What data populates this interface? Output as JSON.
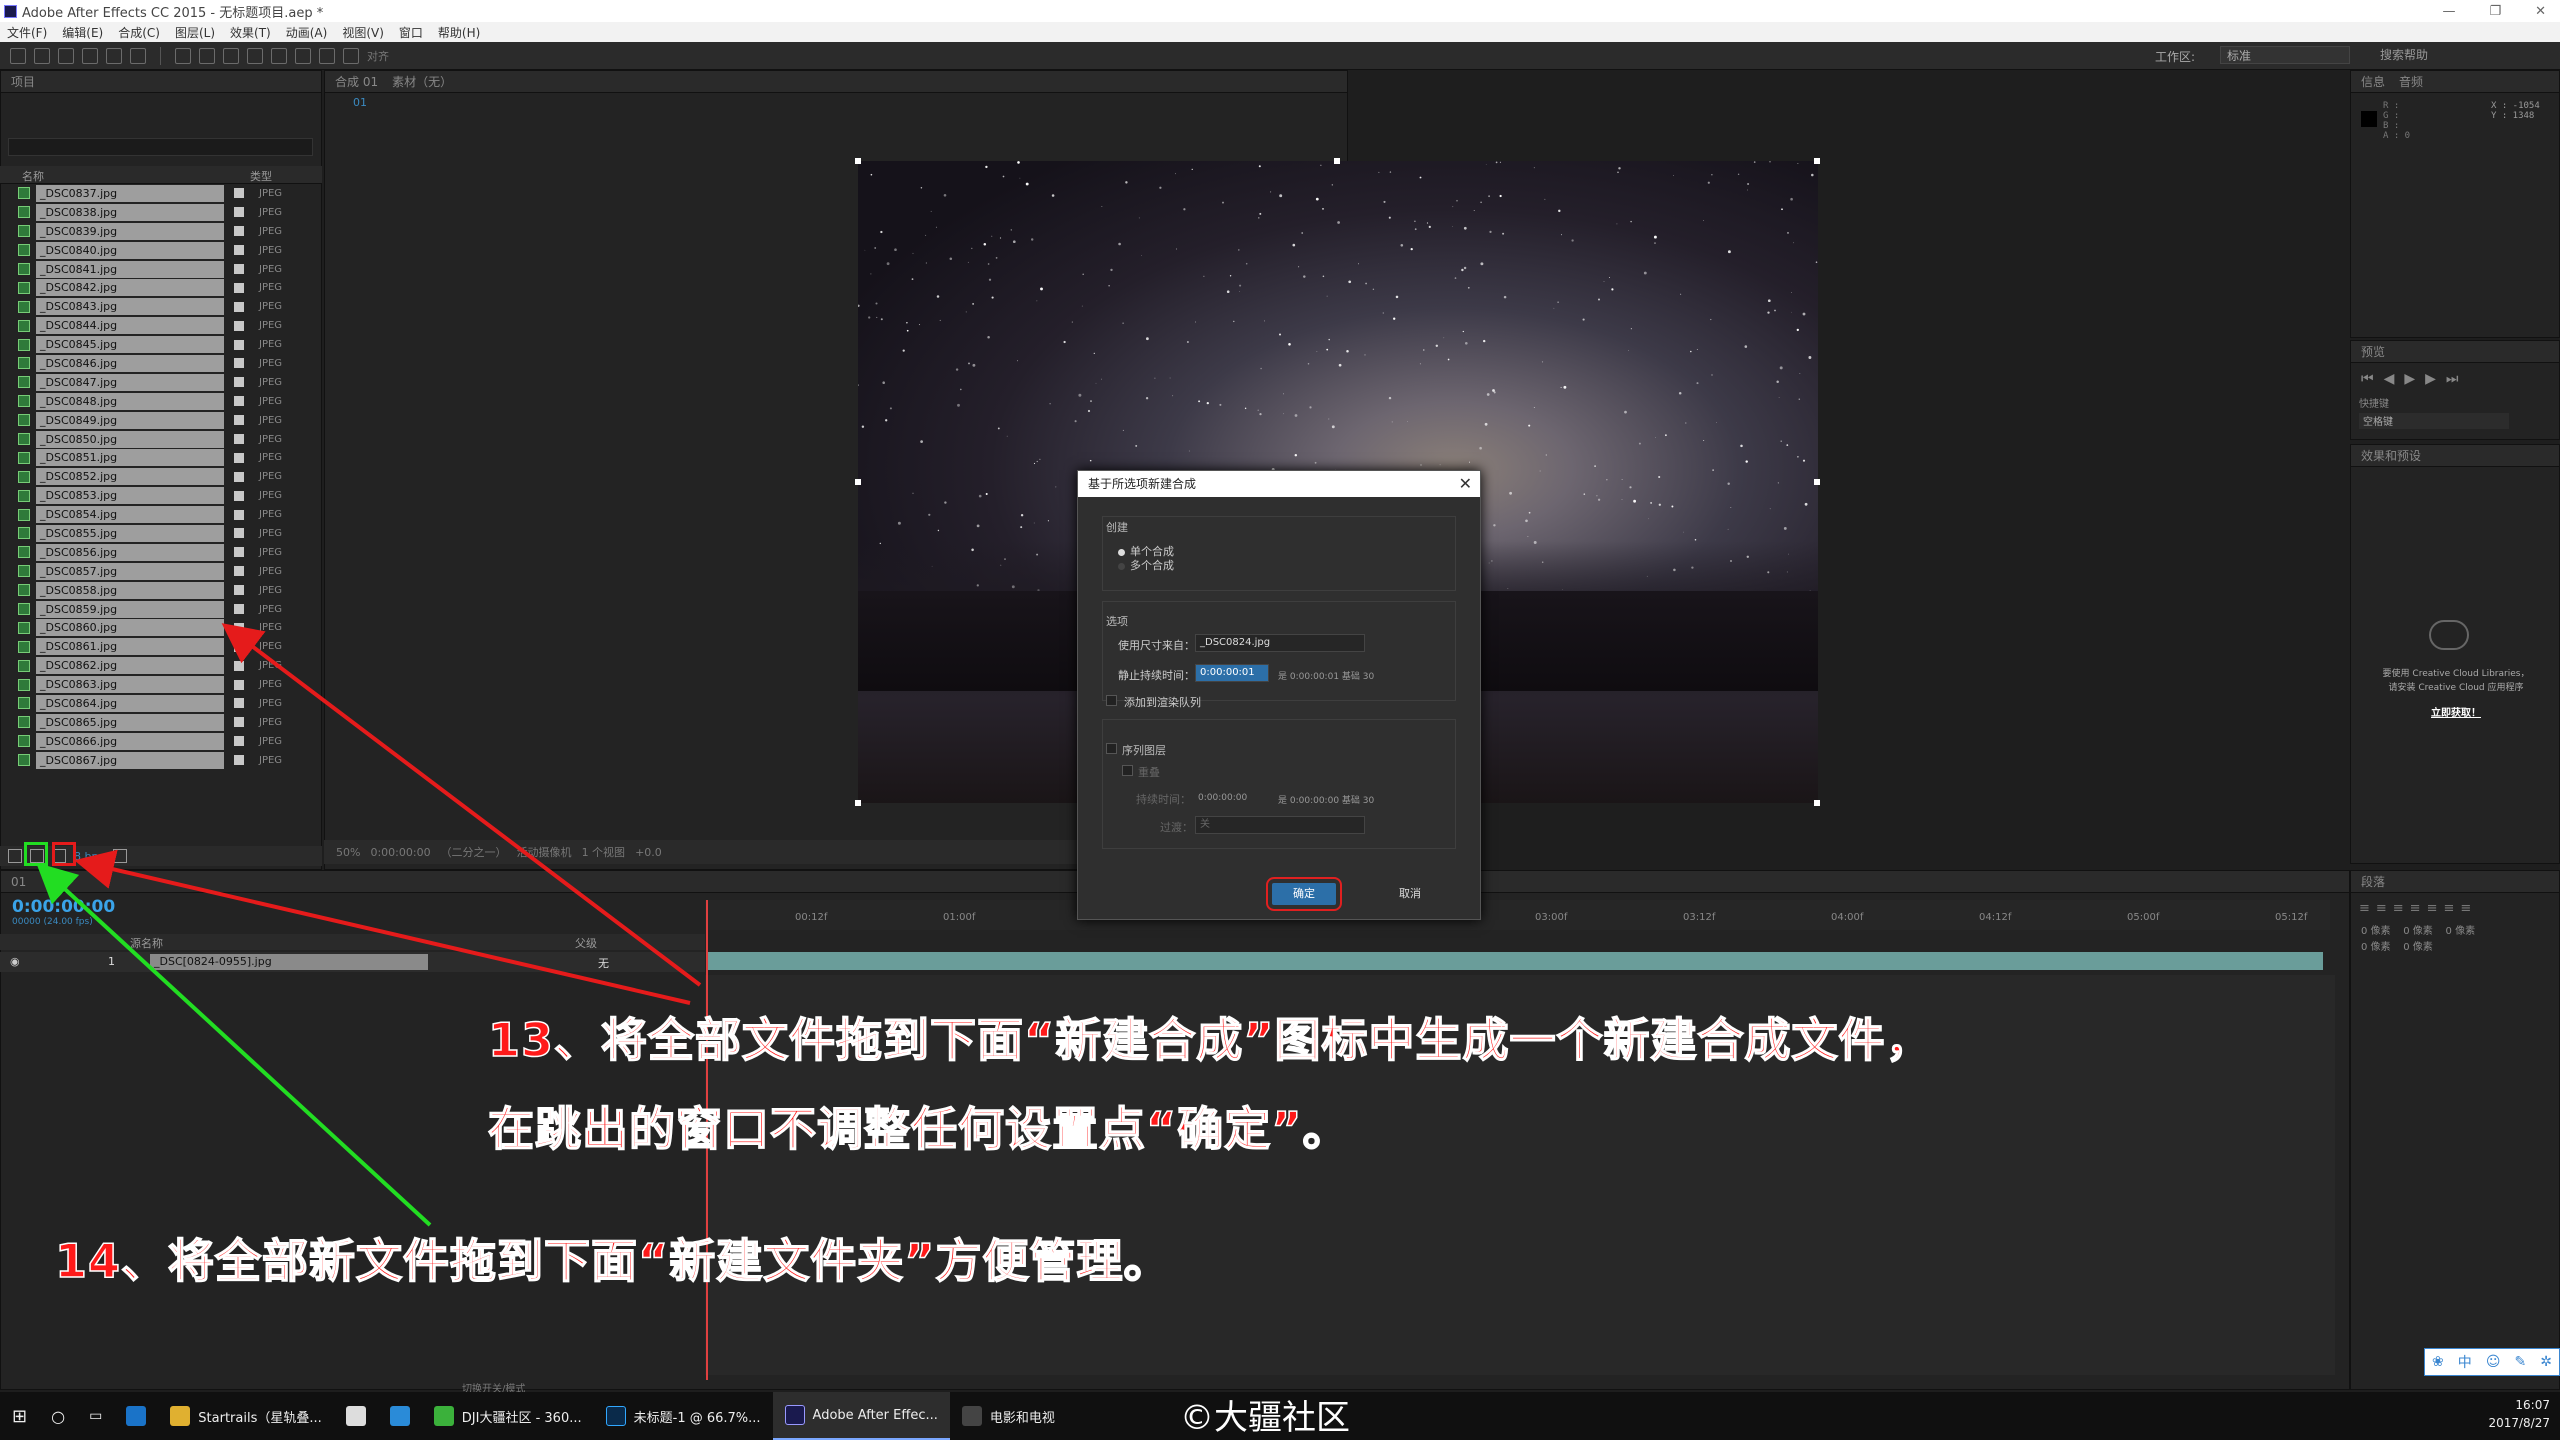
{
  "window": {
    "title": "Adobe After Effects CC 2015 - 无标题项目.aep *",
    "controls": [
      "—",
      "❐",
      "✕"
    ]
  },
  "menu": [
    "文件(F)",
    "编辑(E)",
    "合成(C)",
    "图层(L)",
    "效果(T)",
    "动画(A)",
    "视图(V)",
    "窗口",
    "帮助(H)"
  ],
  "toolbar": {
    "align_label": "对齐",
    "workspace_label": "工作区:",
    "workspace_value": "标准",
    "search_help": "搜索帮助"
  },
  "project": {
    "tab": "项目",
    "col_name": "名称",
    "col_type": "类型",
    "files": [
      "_DSC0837.jpg",
      "_DSC0838.jpg",
      "_DSC0839.jpg",
      "_DSC0840.jpg",
      "_DSC0841.jpg",
      "_DSC0842.jpg",
      "_DSC0843.jpg",
      "_DSC0844.jpg",
      "_DSC0845.jpg",
      "_DSC0846.jpg",
      "_DSC0847.jpg",
      "_DSC0848.jpg",
      "_DSC0849.jpg",
      "_DSC0850.jpg",
      "_DSC0851.jpg",
      "_DSC0852.jpg",
      "_DSC0853.jpg",
      "_DSC0854.jpg",
      "_DSC0855.jpg",
      "_DSC0856.jpg",
      "_DSC0857.jpg",
      "_DSC0858.jpg",
      "_DSC0859.jpg",
      "_DSC0860.jpg",
      "_DSC0861.jpg",
      "_DSC0862.jpg",
      "_DSC0863.jpg",
      "_DSC0864.jpg",
      "_DSC0865.jpg",
      "_DSC0866.jpg",
      "_DSC0867.jpg"
    ],
    "file_type": "JPEG",
    "bpc": "8 bpc"
  },
  "comp": {
    "tab_comp": "合成 01",
    "tab_footage": "素材（无）",
    "breadcrumb": "01",
    "zoom": "50%",
    "timecode": "0:00:00:00",
    "resolution": "（二分之一）",
    "camera": "活动摄像机",
    "views": "1 个视图",
    "exposure": "+0.0"
  },
  "info": {
    "tab_info": "信息",
    "tab_audio": "音频",
    "rgba": "R :\nG :\nB :\nA : 0",
    "xy": "X : -1054\nY : 1348"
  },
  "preview": {
    "tab": "预览",
    "shortcut_label": "快捷键",
    "shortcut_value": "空格键"
  },
  "fx": {
    "tab": "效果和预设",
    "cc_msg1": "要使用 Creative Cloud Libraries，",
    "cc_msg2": "请安装 Creative Cloud 应用程序",
    "cc_link": "立即获取！"
  },
  "paragraph": {
    "tab": "段落",
    "px1": "0 像素",
    "px2": "0 像素",
    "px3": "0 像素",
    "px4": "0 像素",
    "px5": "0 像素"
  },
  "timeline": {
    "tab": "01",
    "time": "0:00:00:00",
    "fps": "00000 (24.00 fps)",
    "ruler": [
      "00:12f",
      "01:00f",
      "01:12f",
      "02:00f",
      "02:12f",
      "03:00f",
      "03:12f",
      "04:00f",
      "04:12f",
      "05:00f",
      "05:12f"
    ],
    "col_source": "源名称",
    "col_parent": "父级",
    "layer_num": "1",
    "layer_name": "_DSC[0824-0955].jpg",
    "layer_parent": "无",
    "footer": "切换开关/模式"
  },
  "dialog": {
    "title": "基于所选项新建合成",
    "create_label": "创建",
    "single": "单个合成",
    "multiple": "多个合成",
    "options_label": "选项",
    "use_dims_label": "使用尺寸来自：",
    "use_dims_value": "_DSC0824.jpg",
    "still_dur_label": "静止持续时间：",
    "still_dur_value": "0:00:00:01",
    "still_dur_note": "是 0:00:00:01  基础 30",
    "add_queue": "添加到渲染队列",
    "seq_label": "序列图层",
    "overlap": "重叠",
    "dur_label": "持续时间：",
    "dur_value": "0:00:00:00",
    "dur_note": "是 0:00:00:00  基础 30",
    "transition_label": "过渡：",
    "transition_value": "关",
    "ok": "确定",
    "cancel": "取消"
  },
  "annotations": {
    "step13_line1": "13、将全部文件拖到下面“新建合成”图标中生成一个新建合成文件，",
    "step13_line2": "在跳出的窗口不调整任何设置点“确定”。",
    "step14": "14、将全部新文件拖到下面“新建文件夹”方便管理。",
    "copyright": "©大疆社区",
    "red_color": "#e51b1b",
    "green_color": "#22dd22"
  },
  "taskbar": {
    "items": [
      "Startrails（星轨叠...",
      "DJI大疆社区 - 360...",
      "未标题-1 @ 66.7%...",
      "Adobe After Effec...",
      "电影和电视"
    ],
    "time": "16:07",
    "date": "2017/8/27",
    "ime": "中"
  }
}
